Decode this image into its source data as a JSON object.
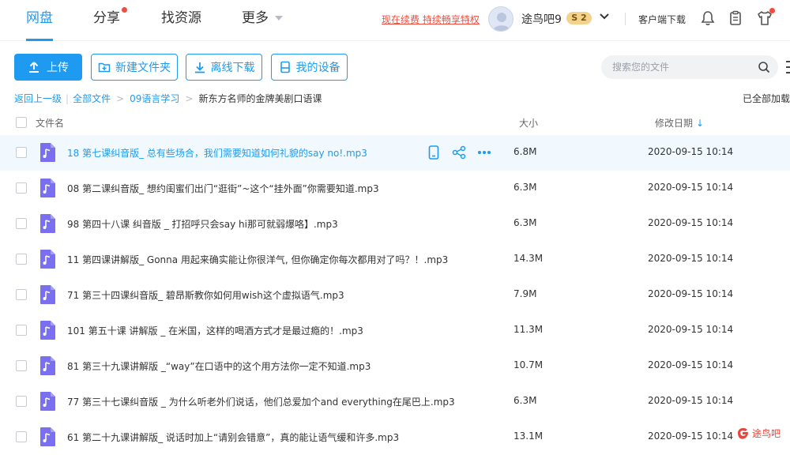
{
  "nav": {
    "items": [
      {
        "label": "网盘",
        "active": true
      },
      {
        "label": "分享",
        "badge_dot": true
      },
      {
        "label": "找资源"
      },
      {
        "label": "更多",
        "dropdown": true
      }
    ]
  },
  "header": {
    "promo_text": "现在续费 持续畅享特权",
    "username": "途鸟吧9",
    "vip_level": "S 2",
    "client_download": "客户端下载",
    "icons": [
      "bell-icon",
      "clipboard-icon",
      "tshirt-icon"
    ]
  },
  "toolbar": {
    "upload_label": "上传",
    "new_folder_label": "新建文件夹",
    "offline_download_label": "离线下载",
    "my_devices_label": "我的设备",
    "search_placeholder": "搜索您的文件"
  },
  "breadcrumb": {
    "back": "返回上一级",
    "items": [
      "全部文件",
      "09语言学习"
    ],
    "current": "新东方名师的金牌美剧口语课",
    "loaded_status": "已全部加载"
  },
  "table": {
    "headers": {
      "name": "文件名",
      "size": "大小",
      "date": "修改日期"
    },
    "rows": [
      {
        "name": "18 第七课纠音版_ 总有些场合，我们需要知道如何礼貌的say no!.mp3",
        "size": "6.8M",
        "date": "2020-09-15 10:14",
        "hover": true
      },
      {
        "name": "08 第二课纠音版_ 想约闺蜜们出门“逛街”~这个“挂外面”你需要知道.mp3",
        "size": "6.3M",
        "date": "2020-09-15 10:14"
      },
      {
        "name": "98 第四十八课 纠音版 _ 打招呼只会say hi那可就弱爆咯】.mp3",
        "size": "6.3M",
        "date": "2020-09-15 10:14"
      },
      {
        "name": "11 第四课讲解版_ Gonna 用起来确实能让你很洋气, 但你确定你每次都用对了吗？！.mp3",
        "size": "14.3M",
        "date": "2020-09-15 10:14"
      },
      {
        "name": "71 第三十四课纠音版_ 碧昂斯教你如何用wish这个虚拟语气.mp3",
        "size": "7.9M",
        "date": "2020-09-15 10:14"
      },
      {
        "name": "101 第五十课 讲解版 _ 在米国，这样的喝酒方式才是最过瘾的！.mp3",
        "size": "11.3M",
        "date": "2020-09-15 10:14"
      },
      {
        "name": "81 第三十九课讲解版 _“way”在口语中的这个用方法你一定不知道.mp3",
        "size": "10.7M",
        "date": "2020-09-15 10:14"
      },
      {
        "name": "77 第三十七课纠音版 _ 为什么听老外们说话，他们总爱加个and everything在尾巴上.mp3",
        "size": "6.3M",
        "date": "2020-09-15 10:14"
      },
      {
        "name": "61 第二十九课讲解版_ 说话时加上“请别会错意”，真的能让语气缓和许多.mp3",
        "size": "13.1M",
        "date": "2020-09-15 10:14"
      }
    ]
  },
  "watermark": "途鸟吧",
  "colors": {
    "accent": "#1e9bf0",
    "promo": "#f04c3d",
    "file_icon": "#7a6ff0"
  }
}
